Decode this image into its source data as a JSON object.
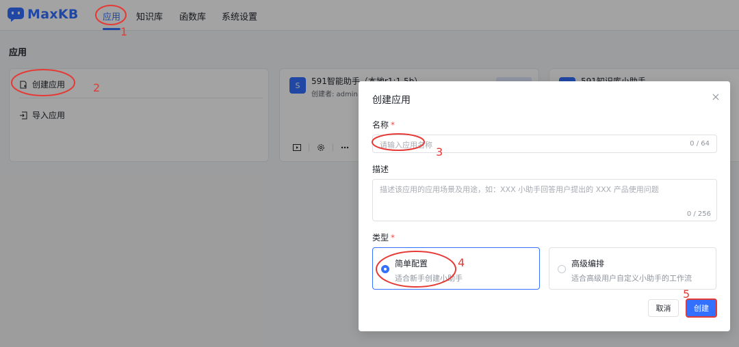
{
  "header": {
    "logo_text": "MaxKB",
    "nav": [
      {
        "label": "应用",
        "active": true
      },
      {
        "label": "知识库",
        "active": false
      },
      {
        "label": "函数库",
        "active": false
      },
      {
        "label": "系统设置",
        "active": false
      }
    ]
  },
  "page": {
    "title": "应用",
    "create_card": {
      "create_label": "创建应用",
      "import_label": "导入应用"
    },
    "apps": [
      {
        "avatar": "S",
        "name": "591智能助手（本地r1:1.5b）",
        "creator": "创建者: admin"
      },
      {
        "avatar": "",
        "name": "591知识库小助手",
        "creator": ""
      }
    ]
  },
  "dialog": {
    "title": "创建应用",
    "name_label": "名称",
    "required_mark": "*",
    "name_placeholder": "请输入应用名称",
    "name_count": "0 / 64",
    "desc_label": "描述",
    "desc_placeholder": "描述该应用的应用场景及用途，如：XXX 小助手回答用户提出的 XXX 产品使用问题",
    "desc_count": "0 / 256",
    "type_label": "类型",
    "types": [
      {
        "title": "简单配置",
        "desc": "适合新手创建小助手",
        "selected": true
      },
      {
        "title": "高级编排",
        "desc": "适合高级用户自定义小助手的工作流",
        "selected": false
      }
    ],
    "cancel_label": "取消",
    "create_label": "创建"
  },
  "annotations": [
    "1",
    "2",
    "3",
    "4",
    "5"
  ],
  "colors": {
    "accent": "#3370ff",
    "annotation": "#e53935"
  }
}
